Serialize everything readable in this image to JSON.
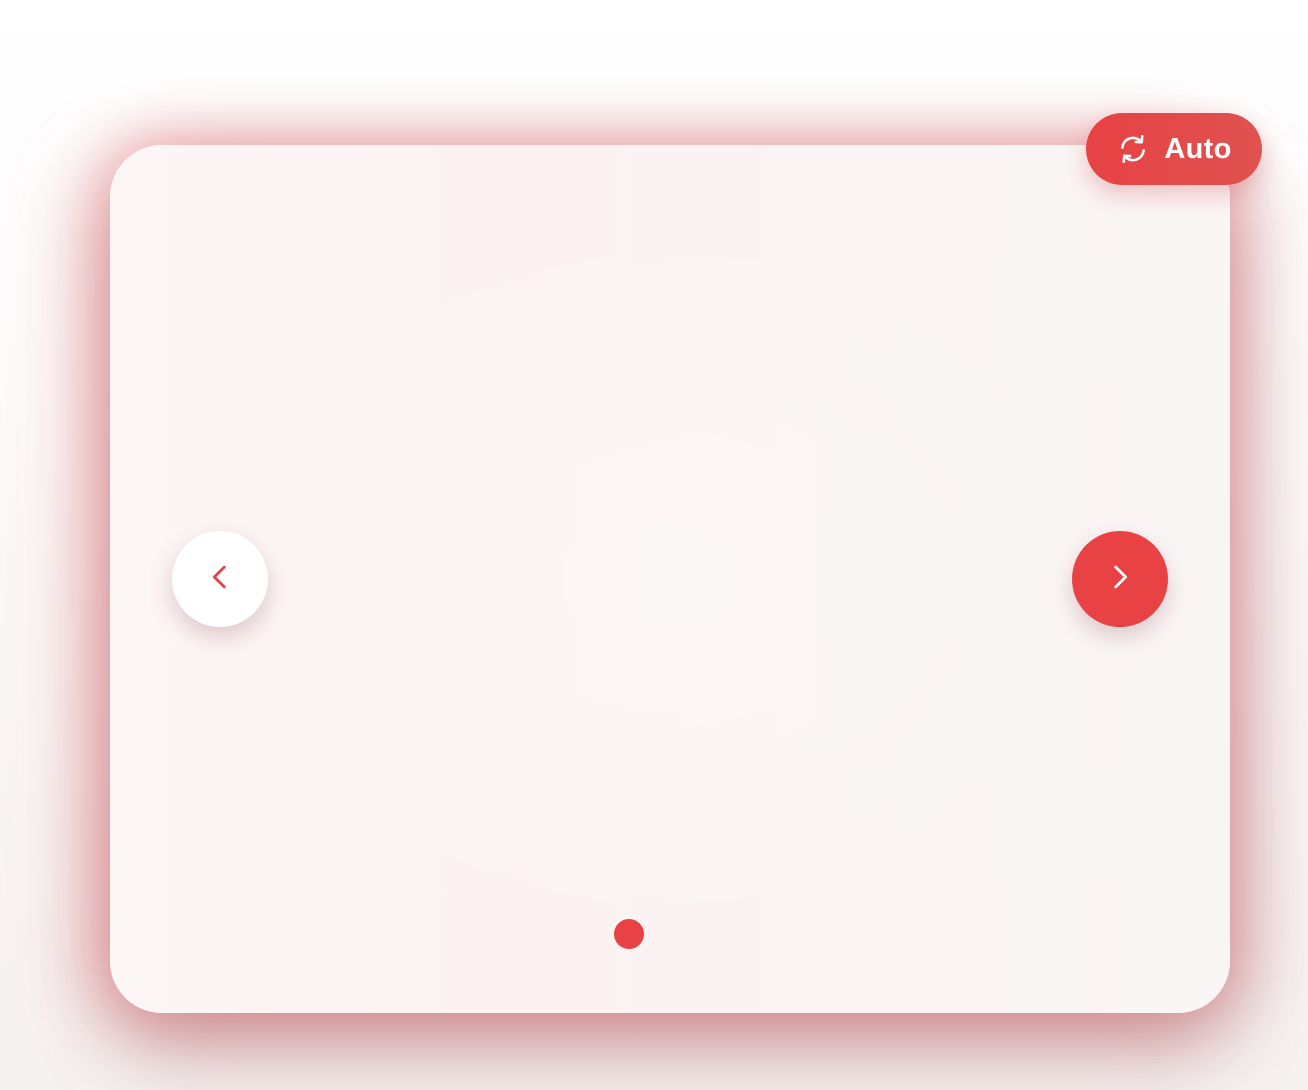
{
  "autoplay": {
    "label": "Auto",
    "icon": "refresh-icon"
  },
  "navigation": {
    "prev_icon": "chevron-left-icon",
    "next_icon": "chevron-right-icon"
  },
  "pagination": {
    "total": 3,
    "active_index": 0
  },
  "colors": {
    "accent": "#e84244",
    "card_background": "#fcf3f3",
    "inactive_dot": "#fbf3f3"
  }
}
